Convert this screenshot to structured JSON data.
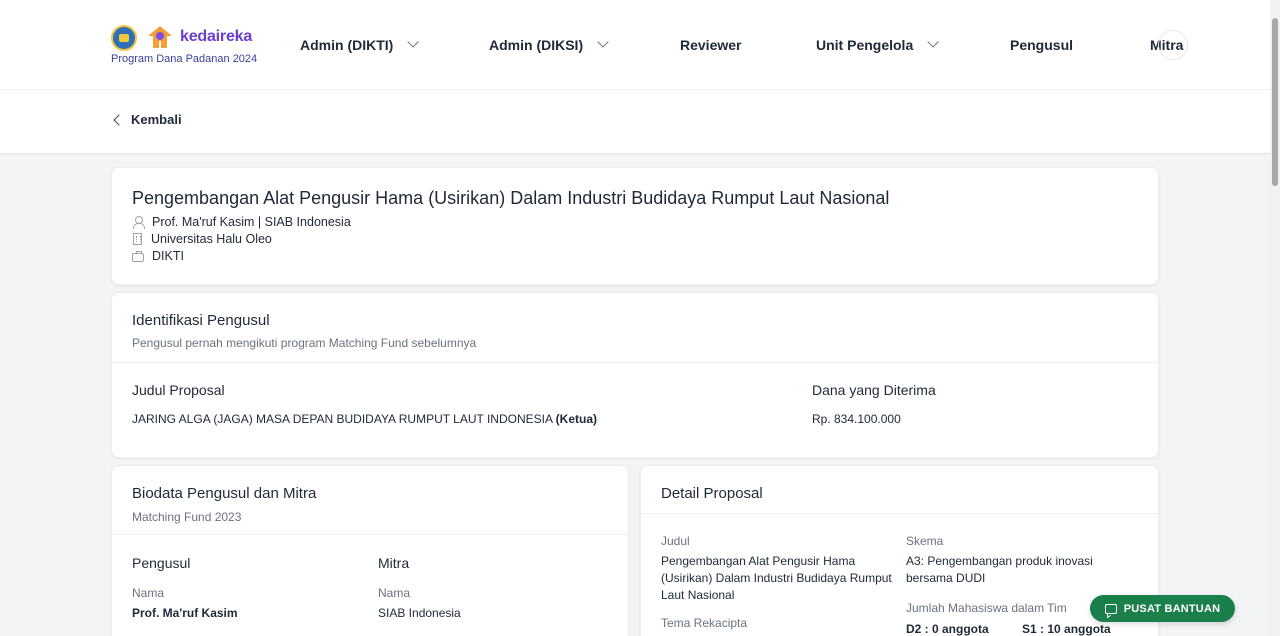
{
  "header": {
    "logo_text": "kedaireka",
    "logo_subtitle": "Program Dana Padanan 2024",
    "nav": [
      {
        "label": "Admin (DIKTI)",
        "dropdown": true
      },
      {
        "label": "Admin (DIKSI)",
        "dropdown": true
      },
      {
        "label": "Reviewer",
        "dropdown": false
      },
      {
        "label": "Unit Pengelola",
        "dropdown": true
      },
      {
        "label": "Pengusul",
        "dropdown": false
      },
      {
        "label": "Mitra",
        "dropdown": false
      }
    ]
  },
  "back_label": "Kembali",
  "proposal_header": {
    "title": "Pengembangan Alat Pengusir Hama (Usirikan) Dalam Industri Budidaya Rumput Laut Nasional",
    "person": "Prof. Ma'ruf Kasim | SIAB Indonesia",
    "university": "Universitas Halu Oleo",
    "directorate": "DIKTI"
  },
  "identifikasi": {
    "title": "Identifikasi Pengusul",
    "subtitle": "Pengusul pernah mengikuti program Matching Fund sebelumnya",
    "col_judul": "Judul Proposal",
    "col_dana": "Dana yang Diterima",
    "row_judul": "JARING ALGA (JAGA) MASA DEPAN BUDIDAYA RUMPUT LAUT INDONESIA",
    "row_role": "(Ketua)",
    "row_dana": "Rp. 834.100.000"
  },
  "biodata": {
    "title": "Biodata Pengusul dan Mitra",
    "subtitle": "Matching Fund 2023",
    "pengusul_heading": "Pengusul",
    "mitra_heading": "Mitra",
    "nama_label": "Nama",
    "pengusul_nama": "Prof. Ma'ruf Kasim",
    "mitra_nama": "SIAB Indonesia"
  },
  "detail": {
    "title": "Detail Proposal",
    "judul_label": "Judul",
    "judul_value": "Pengembangan Alat Pengusir Hama (Usirikan) Dalam Industri Budidaya Rumput Laut Nasional",
    "skema_label": "Skema",
    "skema_value": "A3: Pengembangan produk inovasi bersama DUDI",
    "tema_label": "Tema Rekacipta",
    "jumlah_label": "Jumlah Mahasiswa dalam Tim",
    "d2": "D2 : 0 anggota",
    "s1": "S1 : 10 anggota"
  },
  "help_button": "PUSAT BANTUAN",
  "colors": {
    "brand_purple": "#6a3fd0",
    "help_green": "#1a7f4b"
  }
}
